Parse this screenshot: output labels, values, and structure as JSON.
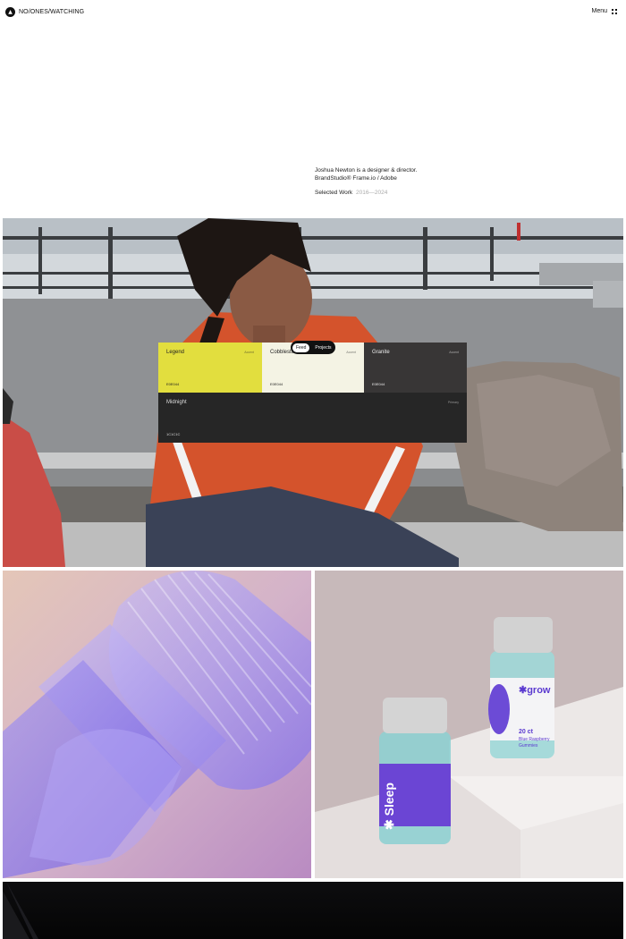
{
  "header": {
    "logo_text": "NO/ONES/WATCHING",
    "logo_icon": "logo-mark-icon",
    "menu_label": "Menu",
    "menu_icon": "grid-dots-icon"
  },
  "intro": {
    "line1": "Joshua Newton is a designer & director.",
    "line2": "BrandStudio® Frame.io / Adobe",
    "work_label": "Selected Work",
    "work_years": "2016—2024"
  },
  "palette": {
    "swatches": [
      {
        "name": "Legend",
        "hex": "E0E044",
        "meta": "Accent",
        "color": "#e2de3e"
      },
      {
        "name": "Cobblestone",
        "hex": "E0E044",
        "meta": "Accent",
        "color": "#f4f3e4"
      },
      {
        "name": "Granite",
        "hex": "E0E044",
        "meta": "Accent",
        "color": "#383636"
      },
      {
        "name": "Midnight",
        "hex": "1C1C1C",
        "meta": "Primary",
        "color": "#262626"
      }
    ]
  },
  "toggle": {
    "options": [
      "Feed",
      "Projects"
    ],
    "active": "Feed"
  },
  "products": {
    "brand": "grow",
    "jar_label": "Sleep",
    "count_text": "20 ct",
    "desc_line1": "Blue Raspberry",
    "desc_line2": "Gummies"
  }
}
